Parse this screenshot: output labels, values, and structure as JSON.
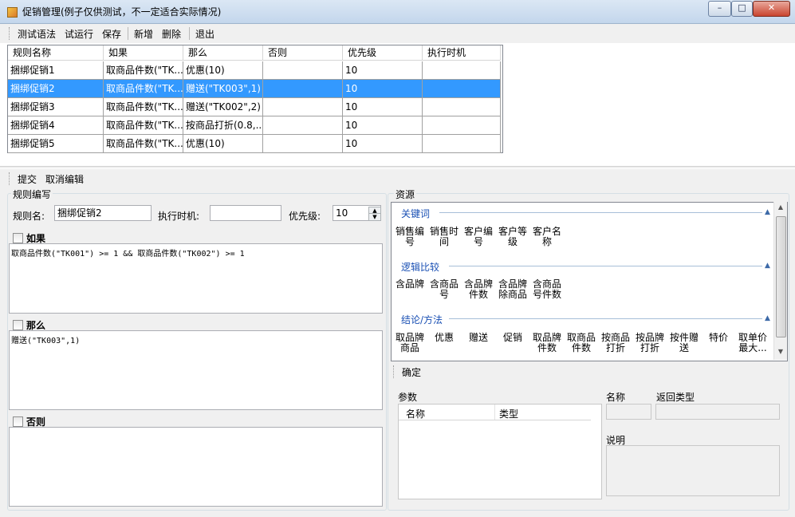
{
  "window": {
    "title": "促销管理(例子仅供测试，不一定适合实际情况)",
    "min": "–",
    "max": "□",
    "close": "✕"
  },
  "toolbar": {
    "items": [
      "测试语法",
      "试运行",
      "保存",
      "新增",
      "删除",
      "退出"
    ]
  },
  "grid": {
    "headers": [
      "规则名称",
      "如果",
      "那么",
      "否则",
      "优先级",
      "执行时机"
    ],
    "rows": [
      [
        "捆绑促销1",
        "取商品件数(\"TK...",
        "优惠(10)",
        "",
        "10",
        ""
      ],
      [
        "捆绑促销2",
        "取商品件数(\"TK...",
        "赠送(\"TK003\",1)",
        "",
        "10",
        ""
      ],
      [
        "捆绑促销3",
        "取商品件数(\"TK...",
        "赠送(\"TK002\",2)",
        "",
        "10",
        ""
      ],
      [
        "捆绑促销4",
        "取商品件数(\"TK...",
        "按商品打折(0.8,...",
        "",
        "10",
        ""
      ],
      [
        "捆绑促销5",
        "取商品件数(\"TK...",
        "优惠(10)",
        "",
        "10",
        ""
      ]
    ],
    "selected_row": 1
  },
  "edit_toolbar": {
    "submit": "提交",
    "cancel": "取消编辑"
  },
  "rule_edit": {
    "group_title": "规则编写",
    "name_label": "规则名:",
    "name_value": "捆绑促销2",
    "timing_label": "执行时机:",
    "timing_value": "",
    "priority_label": "优先级:",
    "priority_value": "10",
    "if_label": "如果",
    "if_value": "取商品件数(\"TK001\") >= 1 &&  取商品件数(\"TK002\") >= 1",
    "then_label": "那么",
    "then_value": "赠送(\"TK003\",1)",
    "else_label": "否则",
    "else_value": ""
  },
  "resources": {
    "group_title": "资源",
    "sections": [
      {
        "title": "关键词",
        "items": [
          "销售编\n号",
          "销售时\n间",
          "客户编\n号",
          "客户等\n级",
          "客户名\n称"
        ]
      },
      {
        "title": "逻辑比较",
        "items": [
          "含品牌",
          "含商品\n号",
          "含品牌\n件数",
          "含品牌\n除商品",
          "含商品\n号件数"
        ]
      },
      {
        "title": "结论/方法",
        "items": [
          "取品牌\n商品",
          "优惠",
          "赠送",
          "促销",
          "取品牌\n件数",
          "取商品\n件数",
          "按商品\n打折",
          "按品牌\n打折",
          "按件赠\n送",
          "特价",
          "取单价\n最大..."
        ]
      }
    ],
    "confirm": "确定",
    "params_label": "参数",
    "params_columns": [
      "名称",
      "类型"
    ],
    "name_label": "名称",
    "return_type_label": "返回类型",
    "desc_label": "说明"
  }
}
